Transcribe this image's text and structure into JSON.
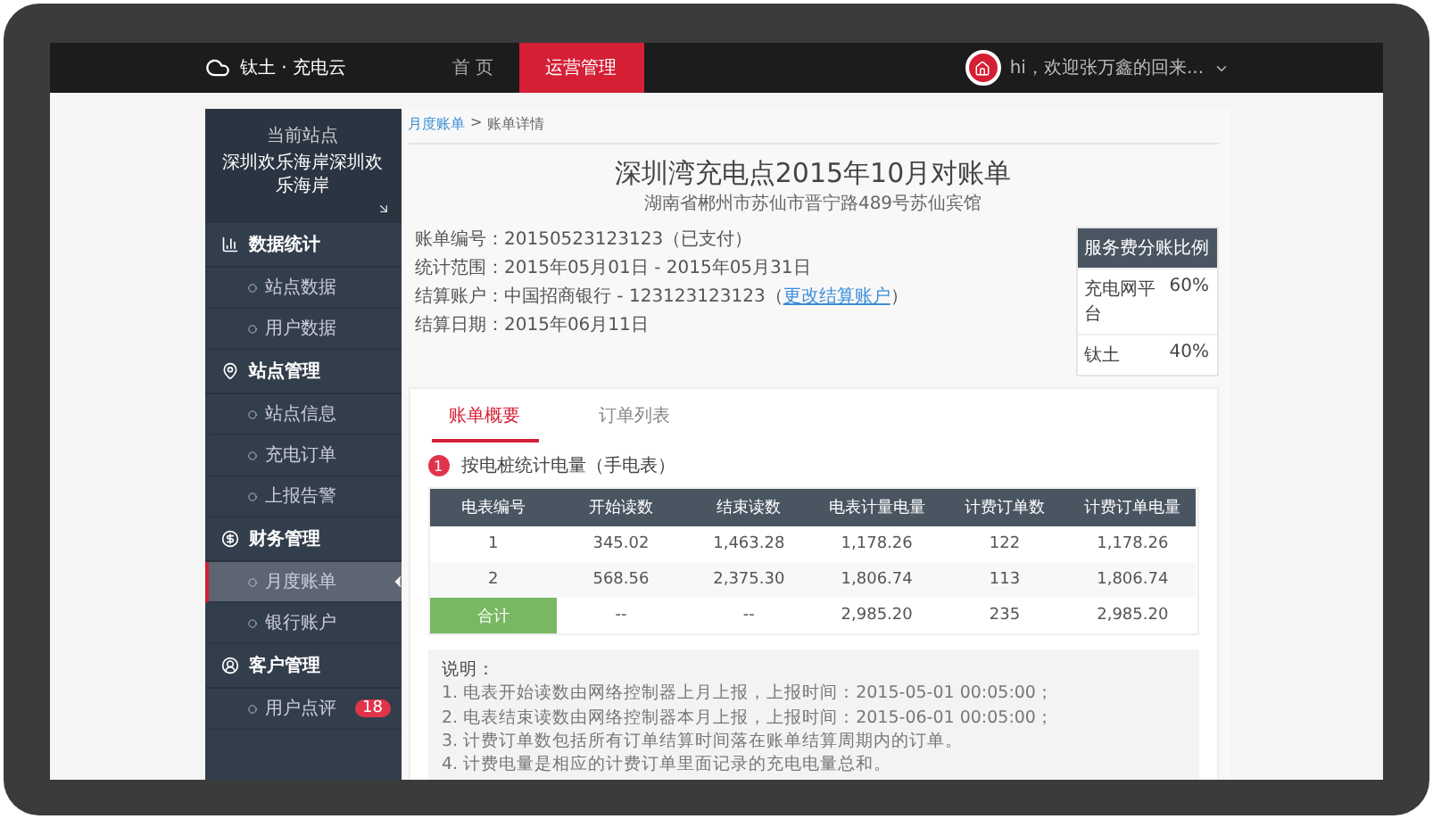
{
  "header": {
    "logo": "钛土 · 充电云",
    "nav": [
      {
        "label": "首 页",
        "selected": false
      },
      {
        "label": "运营管理",
        "selected": true
      }
    ],
    "user": "hi，欢迎张万鑫的回来..."
  },
  "sidebar": {
    "site_label": "当前站点",
    "site_name": "深圳欢乐海岸深圳欢乐海岸",
    "groups": [
      {
        "kind": "stats",
        "label": "数据统计",
        "items": [
          {
            "label": "站点数据",
            "selected": false
          },
          {
            "label": "用户数据",
            "selected": false
          }
        ]
      },
      {
        "kind": "location",
        "label": "站点管理",
        "items": [
          {
            "label": "站点信息",
            "selected": false
          },
          {
            "label": "充电订单",
            "selected": false
          },
          {
            "label": "上报告警",
            "selected": false
          }
        ]
      },
      {
        "kind": "finance",
        "label": "财务管理",
        "items": [
          {
            "label": "月度账单",
            "selected": true
          },
          {
            "label": "银行账户",
            "selected": false
          }
        ]
      },
      {
        "kind": "customer",
        "label": "客户管理",
        "items": [
          {
            "label": "用户点评",
            "selected": false,
            "badge": "18"
          }
        ]
      }
    ]
  },
  "breadcrumb": {
    "link": "月度账单",
    "separator": ">",
    "current": "账单详情"
  },
  "title": "深圳湾充电点2015年10月对账单",
  "address": "湖南省郴州市苏仙市晋宁路489号苏仙宾馆",
  "info": [
    {
      "label": "账单编号：",
      "value": "20150523123123（已支付）"
    },
    {
      "label": "统计范围：",
      "value": "2015年05月01日 - 2015年05月31日"
    },
    {
      "label": "结算账户：",
      "value": "中国招商银行 - 123123123123（",
      "link": "更改结算账户",
      "after": "）"
    },
    {
      "label": "结算日期：",
      "value": "2015年06月11日"
    }
  ],
  "share": {
    "title": "服务费分账比例",
    "rows": [
      {
        "name": "充电网平台",
        "ratio": "60%"
      },
      {
        "name": "钛土",
        "ratio": "40%"
      }
    ]
  },
  "tabs": [
    {
      "label": "账单概要",
      "selected": true
    },
    {
      "label": "订单列表",
      "selected": false
    }
  ],
  "section": {
    "number": "1",
    "title": "按电桩统计电量（手电表）"
  },
  "table": {
    "columns": [
      "电表编号",
      "开始读数",
      "结束读数",
      "电表计量电量",
      "计费订单数",
      "计费订单电量"
    ],
    "rows": [
      [
        "1",
        "345.02",
        "1,463.28",
        "1,178.26",
        "122",
        "1,178.26"
      ],
      [
        "2",
        "568.56",
        "2,375.30",
        "1,806.74",
        "113",
        "1,806.74"
      ]
    ],
    "total": [
      "合计",
      "--",
      "--",
      "2,985.20",
      "235",
      "2,985.20"
    ]
  },
  "notes": {
    "title": "说明：",
    "items": [
      "1. 电表开始读数由网络控制器上月上报，上报时间：2015-05-01 00:05:00；",
      "2. 电表结束读数由网络控制器本月上报，上报时间：2015-06-01 00:05:00；",
      "3. 计费订单数包括所有订单结算时间落在账单结算周期内的订单。",
      "4. 计费电量是相应的计费订单里面记录的充电电量总和。"
    ]
  }
}
